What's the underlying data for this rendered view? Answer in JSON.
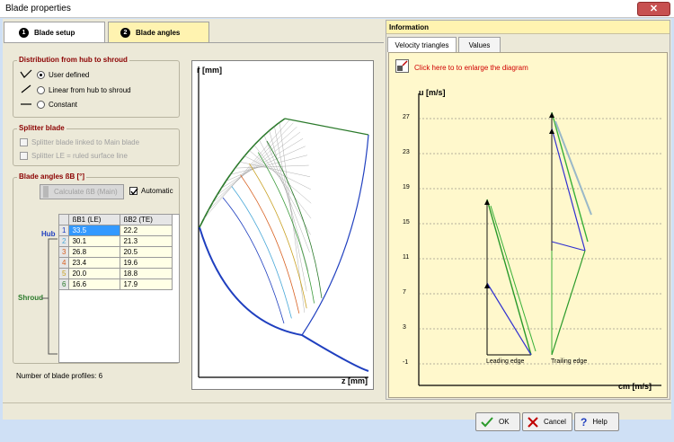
{
  "window": {
    "title": "Blade properties",
    "close_glyph": "✕"
  },
  "tabs": [
    {
      "num": "1",
      "label": "Blade setup"
    },
    {
      "num": "2",
      "label": "Blade angles"
    }
  ],
  "distribution": {
    "title": "Distribution from hub to shroud",
    "options": [
      "User defined",
      "Linear from hub to shroud",
      "Constant"
    ],
    "selected": "User defined"
  },
  "splitter": {
    "title": "Splitter blade",
    "options": [
      "Splitter blade linked to Main blade",
      "Splitter LE = ruled surface line"
    ]
  },
  "angles": {
    "title": "Blade angles ßB [°]",
    "calc_button": "Calculate ßB (Main)",
    "automatic_label": "Automatic",
    "hub_label": "Hub",
    "shroud_label": "Shroud",
    "columns": [
      "ßB1 (LE)",
      "ßB2 (TE)"
    ],
    "rows": [
      {
        "n": "1",
        "le": "33.5",
        "te": "22.2"
      },
      {
        "n": "2",
        "le": "30.1",
        "te": "21.3"
      },
      {
        "n": "3",
        "le": "26.8",
        "te": "20.5"
      },
      {
        "n": "4",
        "le": "23.4",
        "te": "19.6"
      },
      {
        "n": "5",
        "le": "20.0",
        "te": "18.8"
      },
      {
        "n": "6",
        "le": "16.6",
        "te": "17.9"
      }
    ],
    "profiles_text": "Number of blade profiles: 6"
  },
  "meridional": {
    "ylabel": "r [mm]",
    "xlabel": "z [mm]"
  },
  "info": {
    "title": "Information",
    "tabs": [
      "Velocity triangles",
      "Values"
    ],
    "enlarge_text": "Click here to to enlarge the diagram"
  },
  "velocity_chart": {
    "ylabel": "u [m/s]",
    "xlabel": "cm [m/s]",
    "yticks": [
      "27",
      "23",
      "19",
      "15",
      "11",
      "7",
      "3",
      "-1"
    ],
    "leading_edge_label": "Leading edge",
    "trailing_edge_label": "Trailing edge"
  },
  "buttons": {
    "ok": "OK",
    "cancel": "Cancel",
    "help": "Help"
  },
  "colors": {
    "profile_colors": [
      "#1f3fbf",
      "#48a8d8",
      "#d86020",
      "#c8a020",
      "#3a9a3a",
      "#2b7a2b"
    ]
  }
}
